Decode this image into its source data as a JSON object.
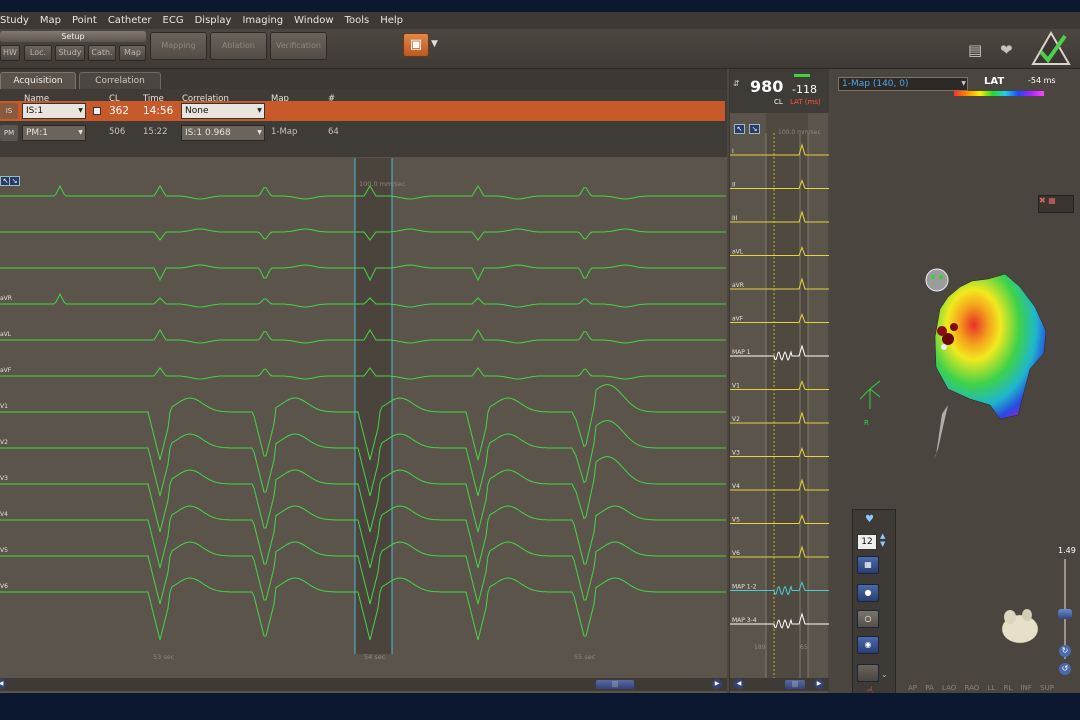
{
  "menu": [
    "Study",
    "Map",
    "Point",
    "Catheter",
    "ECG",
    "Display",
    "Imaging",
    "Window",
    "Tools",
    "Help"
  ],
  "toolbar": {
    "setup_label": "Setup",
    "sub_tabs": [
      "HW",
      "Loc.",
      "Study",
      "Cath.",
      "Map"
    ],
    "big_tabs": [
      "Mapping",
      "Ablation",
      "Verification"
    ]
  },
  "left_tabs": {
    "active": "Acquisition",
    "inactive": "Correlation"
  },
  "grid": {
    "headers": {
      "name": "Name",
      "cl": "CL",
      "time": "Time",
      "correlation": "Correlation",
      "map": "Map",
      "count": "#"
    },
    "rows": [
      {
        "tag": "IS",
        "name": "IS:1",
        "cl": "362",
        "time": "14:56",
        "correlation": "None",
        "map": "",
        "count": ""
      },
      {
        "tag": "PM",
        "name": "PM:1",
        "cl": "506",
        "time": "15:22",
        "correlation": "IS:1  0.968",
        "map": "1-Map",
        "count": "64"
      }
    ]
  },
  "ecg": {
    "speed_label": "100.0 mm/sec",
    "time_labels": [
      "53 sec",
      "54 sec",
      "55 sec"
    ],
    "lead_labels": [
      "",
      "",
      "",
      "aVR",
      "aVL",
      "aVF",
      "V1",
      "V2",
      "V3",
      "V4",
      "V5",
      "V6"
    ],
    "trace_color": "#47d347"
  },
  "mid": {
    "cl_value": "980",
    "lat_value": "-118",
    "cl_label": "CL",
    "lat_label": "LAT (ms)",
    "speed_label": "100.0 mm/sec",
    "leads": [
      "I",
      "II",
      "III",
      "aVL",
      "aVR",
      "aVF",
      "MAP 1",
      "V1",
      "V2",
      "V3",
      "V4",
      "V5",
      "V6",
      "MAP 1-2",
      "MAP 3-4"
    ],
    "bottom_labels": [
      "189",
      "65"
    ],
    "trace_color": "#e7d23a"
  },
  "right": {
    "map_select": "1-Map (140, 0)",
    "lat_title": "LAT",
    "lat_ms": "-54 ms",
    "zoom_value": "1.49",
    "stepper_value": "12",
    "view_buttons": [
      "AP",
      "PA",
      "LAO",
      "RAO",
      "LL",
      "RL",
      "INF",
      "SUP"
    ],
    "axis_label": "R"
  }
}
